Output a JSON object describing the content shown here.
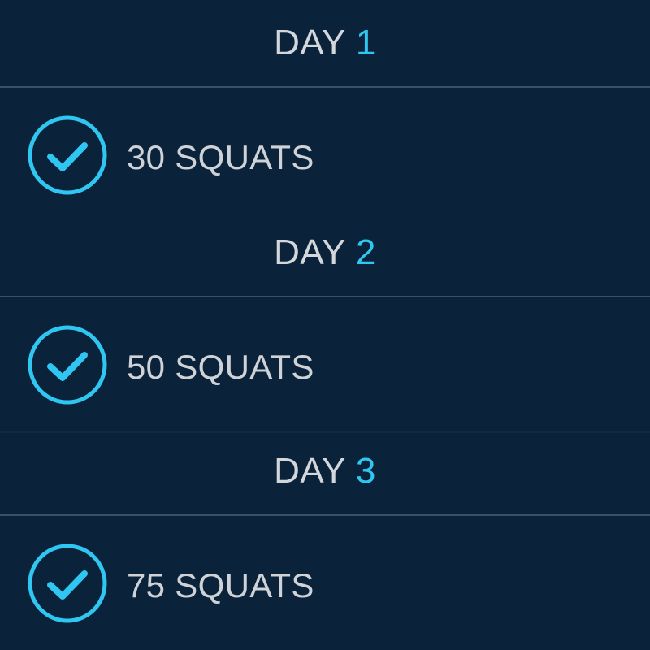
{
  "days": [
    {
      "day_word": "DAY",
      "day_number": "1",
      "task": "30 SQUATS",
      "completed": true
    },
    {
      "day_word": "DAY",
      "day_number": "2",
      "task": "50 SQUATS",
      "completed": true
    },
    {
      "day_word": "DAY",
      "day_number": "3",
      "task": "75 SQUATS",
      "completed": true
    }
  ],
  "colors": {
    "background": "#0b233a",
    "accent": "#2fc6f2",
    "text": "#d3d7dc",
    "divider": "#3a5066"
  },
  "icons": {
    "completed": "check-circle-icon"
  }
}
